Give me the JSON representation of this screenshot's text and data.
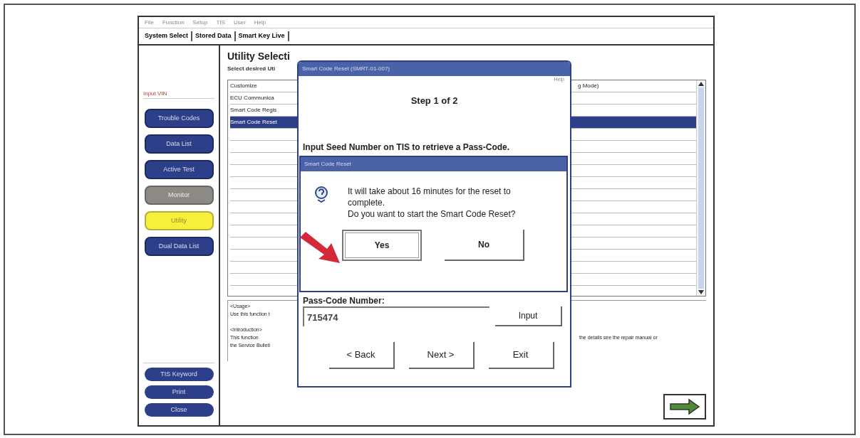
{
  "menu": [
    "File",
    "Function",
    "Setup",
    "TIS",
    "User",
    "Help"
  ],
  "tabs": [
    "System Select",
    "Stored Data",
    "Smart Key Live"
  ],
  "sidebar": {
    "vin_label": "Input VIN",
    "items": [
      {
        "label": "Trouble Codes",
        "selected": false,
        "disabled": false
      },
      {
        "label": "Data List",
        "selected": false,
        "disabled": false
      },
      {
        "label": "Active Test",
        "selected": false,
        "disabled": false
      },
      {
        "label": "Monitor",
        "selected": false,
        "disabled": true
      },
      {
        "label": "Utility",
        "selected": true,
        "disabled": false
      },
      {
        "label": "Dual Data List",
        "selected": false,
        "disabled": false
      }
    ],
    "bottom_buttons": [
      "TIS Keyword",
      "Print",
      "Close"
    ]
  },
  "content": {
    "title": "Utility Selecti",
    "subtitle": "Select desired Uti",
    "list": [
      {
        "label": "Customize",
        "column_2": "g Mode)",
        "selected": false
      },
      {
        "label": "ECU Communica",
        "selected": false
      },
      {
        "label": "Smart Code Regis",
        "selected": false
      },
      {
        "label": "Smart Code Reset",
        "selected": true
      }
    ],
    "usage": [
      {
        "kind": "heading",
        "left": "<Usage>"
      },
      {
        "kind": "text",
        "left": "Use this function t"
      },
      {
        "kind": "heading",
        "left": "<Introduction>"
      },
      {
        "kind": "text",
        "left": "This function",
        "right": "the details see the repair manual or"
      },
      {
        "kind": "text",
        "left": "the Service Bulleti"
      }
    ]
  },
  "wizard": {
    "title": "Smart Code Reset (SMRT-01-007)",
    "help": "Help",
    "step": "Step 1 of 2",
    "instruction": "Input Seed Number on TIS to retrieve a Pass-Code.",
    "passcode_label": "Pass-Code Number:",
    "value": "715474",
    "input_button": "Input",
    "buttons": [
      "< Back",
      "Next >",
      "Exit"
    ]
  },
  "confirm": {
    "title": "Smart Code Reset",
    "message": [
      "It will take about 16 minutes for the reset to complete.",
      "Do you want to start the Smart Code Reset?"
    ],
    "buttons": [
      {
        "label": "Yes",
        "focused": true
      },
      {
        "label": "No",
        "focused": false
      }
    ]
  }
}
